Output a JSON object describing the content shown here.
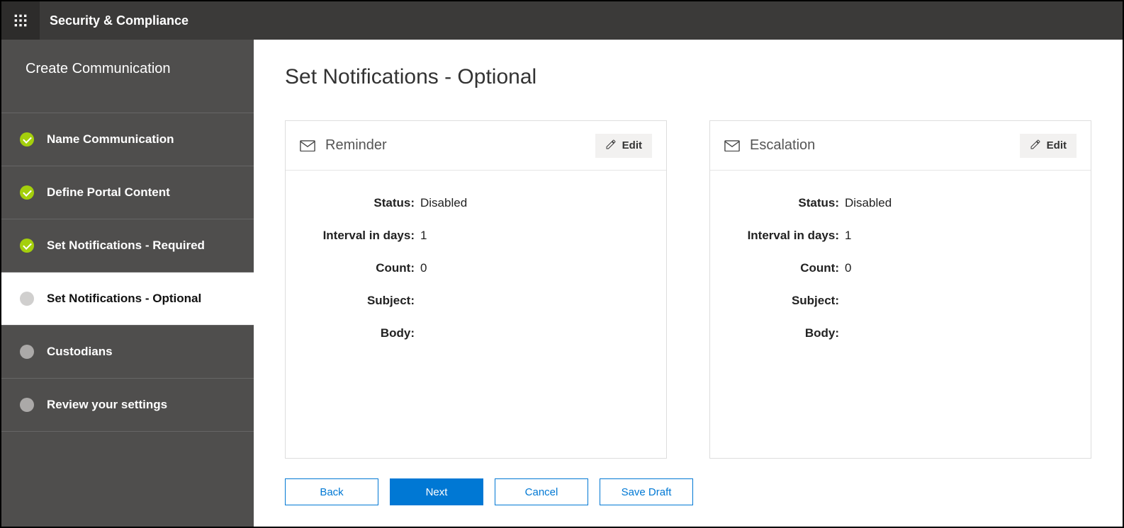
{
  "header": {
    "title": "Security & Compliance"
  },
  "sidebar": {
    "heading": "Create Communication",
    "steps": [
      {
        "label": "Name Communication",
        "state": "done"
      },
      {
        "label": "Define Portal Content",
        "state": "done"
      },
      {
        "label": "Set Notifications - Required",
        "state": "done"
      },
      {
        "label": "Set Notifications - Optional",
        "state": "active"
      },
      {
        "label": "Custodians",
        "state": "pending"
      },
      {
        "label": "Review your settings",
        "state": "pending"
      }
    ]
  },
  "page": {
    "title": "Set Notifications - Optional"
  },
  "cards": {
    "reminder": {
      "title": "Reminder",
      "edit": "Edit",
      "fields": {
        "status_label": "Status:",
        "status_value": "Disabled",
        "interval_label": "Interval in days:",
        "interval_value": "1",
        "count_label": "Count:",
        "count_value": "0",
        "subject_label": "Subject:",
        "subject_value": "",
        "body_label": "Body:",
        "body_value": ""
      }
    },
    "escalation": {
      "title": "Escalation",
      "edit": "Edit",
      "fields": {
        "status_label": "Status:",
        "status_value": "Disabled",
        "interval_label": "Interval in days:",
        "interval_value": "1",
        "count_label": "Count:",
        "count_value": "0",
        "subject_label": "Subject:",
        "subject_value": "",
        "body_label": "Body:",
        "body_value": ""
      }
    }
  },
  "footer": {
    "back": "Back",
    "next": "Next",
    "cancel": "Cancel",
    "save_draft": "Save Draft"
  }
}
